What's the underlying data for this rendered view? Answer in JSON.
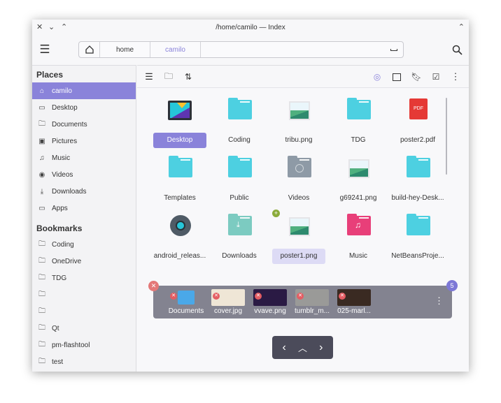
{
  "window": {
    "title": "/home/camilo — Index"
  },
  "pathbar": {
    "crumbs": [
      "home",
      "camilo"
    ]
  },
  "sidebar": {
    "places_header": "Places",
    "places": [
      {
        "label": "camilo",
        "icon": "home-icon"
      },
      {
        "label": "Desktop",
        "icon": "desktop-icon"
      },
      {
        "label": "Documents",
        "icon": "folder-icon"
      },
      {
        "label": "Pictures",
        "icon": "image-icon"
      },
      {
        "label": "Music",
        "icon": "music-icon"
      },
      {
        "label": "Videos",
        "icon": "video-icon"
      },
      {
        "label": "Downloads",
        "icon": "download-icon"
      },
      {
        "label": "Apps",
        "icon": "apps-icon"
      }
    ],
    "bookmarks_header": "Bookmarks",
    "bookmarks": [
      "Coding",
      "OneDrive",
      "TDG",
      "",
      "",
      "Qt",
      "pm-flashtool",
      "test"
    ]
  },
  "files": [
    {
      "name": "Desktop",
      "type": "desktop",
      "selected": true
    },
    {
      "name": "Coding",
      "type": "folder"
    },
    {
      "name": "tribu.png",
      "type": "image"
    },
    {
      "name": "TDG",
      "type": "folder"
    },
    {
      "name": "poster2.pdf",
      "type": "pdf"
    },
    {
      "name": "Templates",
      "type": "folder"
    },
    {
      "name": "Public",
      "type": "folder"
    },
    {
      "name": "Videos",
      "type": "videos"
    },
    {
      "name": "g69241.png",
      "type": "image"
    },
    {
      "name": "build-hey-Desk...",
      "type": "folder"
    },
    {
      "name": "android_releas...",
      "type": "gear"
    },
    {
      "name": "Downloads",
      "type": "downloads"
    },
    {
      "name": "poster1.png",
      "type": "image",
      "hover": true
    },
    {
      "name": "Music",
      "type": "music"
    },
    {
      "name": "NetBeansProje...",
      "type": "folder"
    }
  ],
  "pdf_label": "PDF",
  "selection": {
    "count": "5",
    "items": [
      {
        "name": "Documents",
        "color": "#4aa8e8"
      },
      {
        "name": "cover.jpg",
        "color": "#efe6d6"
      },
      {
        "name": "vvave.png",
        "color": "#2a1a44"
      },
      {
        "name": "tumblr_m...",
        "color": "#9a9a98"
      },
      {
        "name": "025-marl...",
        "color": "#3a2a22"
      }
    ]
  },
  "colors": {
    "accent": "#8a83da",
    "folder": "#4dd0e1"
  }
}
